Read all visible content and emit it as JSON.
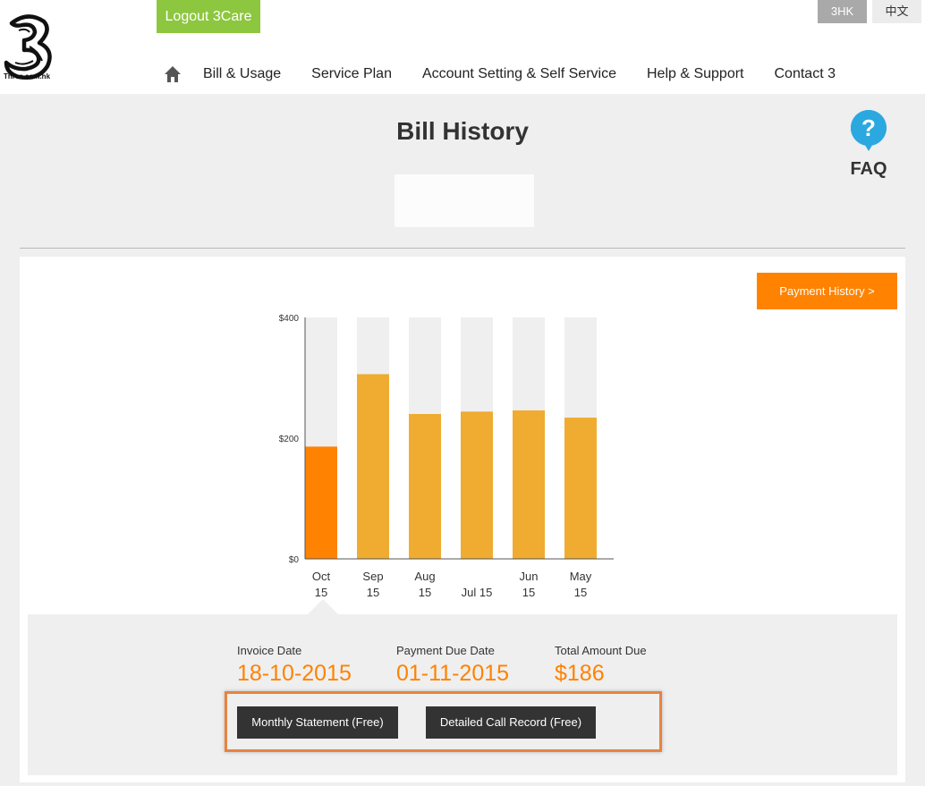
{
  "header": {
    "logo_text": "Three.com.hk",
    "logout_label": "Logout 3Care",
    "lang": {
      "hk_label": "3HK",
      "zh_label": "中文"
    },
    "nav": [
      "Bill & Usage",
      "Service Plan",
      "Account Setting & Self Service",
      "Help & Support",
      "Contact 3"
    ]
  },
  "page": {
    "title": "Bill History",
    "faq_label": "FAQ"
  },
  "panel": {
    "payment_history_label": "Payment History >"
  },
  "chart_data": {
    "type": "bar",
    "categories": [
      [
        "Oct",
        "15"
      ],
      [
        "Sep",
        "15"
      ],
      [
        "Aug",
        "15"
      ],
      [
        "Jul 15",
        ""
      ],
      [
        "Jun",
        "15"
      ],
      [
        "May",
        "15"
      ]
    ],
    "values": [
      186,
      306,
      240,
      244,
      246,
      234
    ],
    "y_ticks": [
      "$0",
      "$200",
      "$400"
    ],
    "ylim": [
      0,
      400
    ],
    "selected_index": 0,
    "colors": {
      "selected": "#ff8200",
      "bar": "#efac30",
      "track": "#efefef",
      "axis": "#555555"
    }
  },
  "details": {
    "invoice_label": "Invoice Date",
    "invoice_value": "18-10-2015",
    "due_label": "Payment Due Date",
    "due_value": "01-11-2015",
    "total_label": "Total Amount Due",
    "total_value": "$186",
    "monthly_btn": "Monthly Statement (Free)",
    "call_record_btn": "Detailed Call Record (Free)"
  }
}
